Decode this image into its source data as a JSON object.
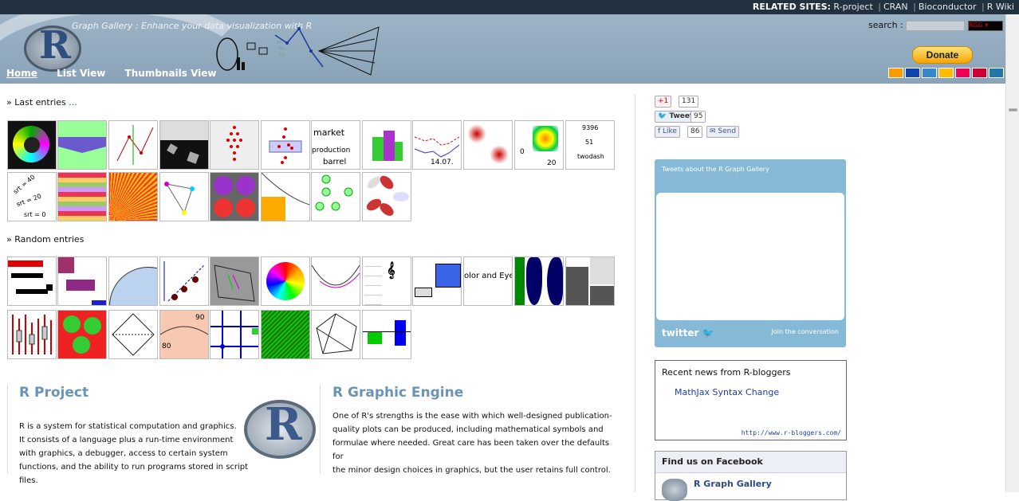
{
  "related": {
    "label": "RELATED SITES:",
    "links": [
      "R-project",
      "CRAN",
      "Bioconductor",
      "R Wiki"
    ]
  },
  "header": {
    "tagline": "Graph Gallery : Enhance your data visualization with R"
  },
  "nav": {
    "items": [
      "Home",
      "List View",
      "Thumbnails View"
    ]
  },
  "search": {
    "label": "search :",
    "select_value": "RGG"
  },
  "donate": {
    "label": "Donate"
  },
  "last_entries": {
    "label": "» Last entries",
    "more": "..."
  },
  "random_entries": {
    "label": "» Random entries"
  },
  "thumb_text": {
    "t1_11": "9396",
    "t1_11b": "51",
    "t1_11c": "twodash",
    "t1_10": "20",
    "t1_10b": "0",
    "t1_8": "14.07.",
    "t1_6w": [
      "market",
      "production",
      "barrel"
    ],
    "t2_1": [
      "srt = 40",
      "srt = 20",
      "srt = 0"
    ],
    "r1_10": "olor and Eye",
    "r2_3": [
      "90",
      "80"
    ]
  },
  "share": {
    "gplus_count": "131",
    "tweet_label": "Tweet",
    "tweet_count": "95",
    "like_label": "Like",
    "like_count": "86",
    "send_label": "Send",
    "plus_label": "+1"
  },
  "twitter": {
    "title": "Tweets about the R Graph Gallery",
    "brand": "twitter",
    "join": "Join the conversation"
  },
  "rbloggers": {
    "title": "Recent news from R-bloggers",
    "article": "MathJax Syntax Change",
    "url": "http://www.r-bloggers.com/"
  },
  "facebook": {
    "title": "Find us on Facebook",
    "page_name": "R Graph Gallery"
  },
  "r_project": {
    "title": "R Project",
    "lines": [
      "R is a system for statistical computation and graphics.",
      "It consists of a language plus a run-time environment",
      "with graphics, a debugger, access to certain system",
      "functions, and the ability to run programs stored in script files."
    ]
  },
  "r_graphic": {
    "title": "R Graphic Engine",
    "lines": [
      "One of R's strengths is the ease with which well-designed publication-",
      "quality plots can be produced, including mathematical symbols and",
      "formulae where needed. Great care has been taken over the defaults for",
      "the minor design choices in graphics, but the user retains full control."
    ]
  }
}
